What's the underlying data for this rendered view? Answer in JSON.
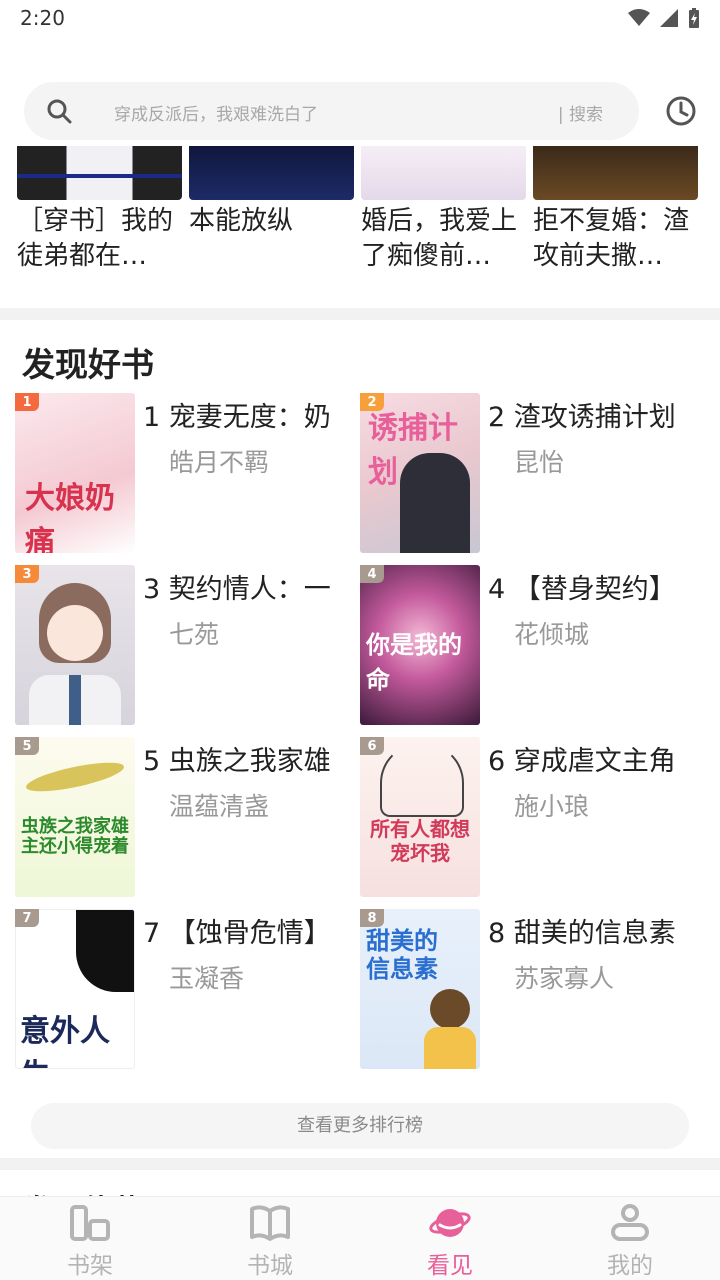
{
  "status_bar": {
    "time": "2:20"
  },
  "search": {
    "placeholder": "穿成反派后，我艰难洗白了",
    "button": "| 搜索"
  },
  "strip": {
    "items": [
      {
        "title": "［穿书］我的徒弟都在…"
      },
      {
        "title": "本能放纵"
      },
      {
        "title": "婚后，我爱上了痴傻前…"
      },
      {
        "title": "拒不复婚：渣攻前夫撒…"
      }
    ]
  },
  "discover": {
    "title": "发现好书",
    "books": [
      {
        "rank": "1",
        "title": "1 宠妻无度：奶",
        "author": "皓月不羁",
        "cover_text": "大娘奶痛",
        "badge_color": "#f26a3d"
      },
      {
        "rank": "2",
        "title": "2 渣攻诱捕计划",
        "author": "昆怡",
        "cover_text": "诱捕计划",
        "badge_color": "#f5a03a"
      },
      {
        "rank": "3",
        "title": "3 契约情人：一",
        "author": "七苑",
        "cover_text": "",
        "badge_color": "#f58a3a"
      },
      {
        "rank": "4",
        "title": "4 【替身契约】",
        "author": "花倾城",
        "cover_text": "你是我的命",
        "badge_color": "#a89a8f"
      },
      {
        "rank": "5",
        "title": "5 虫族之我家雄",
        "author": "温蕴清盏",
        "cover_text": "虫族之我家雄主还小得宠着",
        "badge_color": "#a89a8f"
      },
      {
        "rank": "6",
        "title": "6 穿成虐文主角",
        "author": "施小琅",
        "cover_text": "所有人都想宠坏我",
        "badge_color": "#a89a8f"
      },
      {
        "rank": "7",
        "title": "7 【蚀骨危情】",
        "author": "玉凝香",
        "cover_text": "意外人生",
        "badge_color": "#a89a8f"
      },
      {
        "rank": "8",
        "title": "8 甜美的信息素",
        "author": "苏家寡人",
        "cover_text": "甜美的信息素",
        "badge_color": "#a89a8f"
      }
    ],
    "more_button": "查看更多排行榜"
  },
  "peek_title": "发现佳慕",
  "nav": {
    "tabs": [
      {
        "label": "书架",
        "icon": "bookshelf-icon"
      },
      {
        "label": "书城",
        "icon": "book-open-icon"
      },
      {
        "label": "看见",
        "icon": "planet-icon",
        "active": true
      },
      {
        "label": "我的",
        "icon": "profile-icon"
      }
    ],
    "active_color": "#e8609a",
    "inactive_color": "#b4b4b4"
  }
}
